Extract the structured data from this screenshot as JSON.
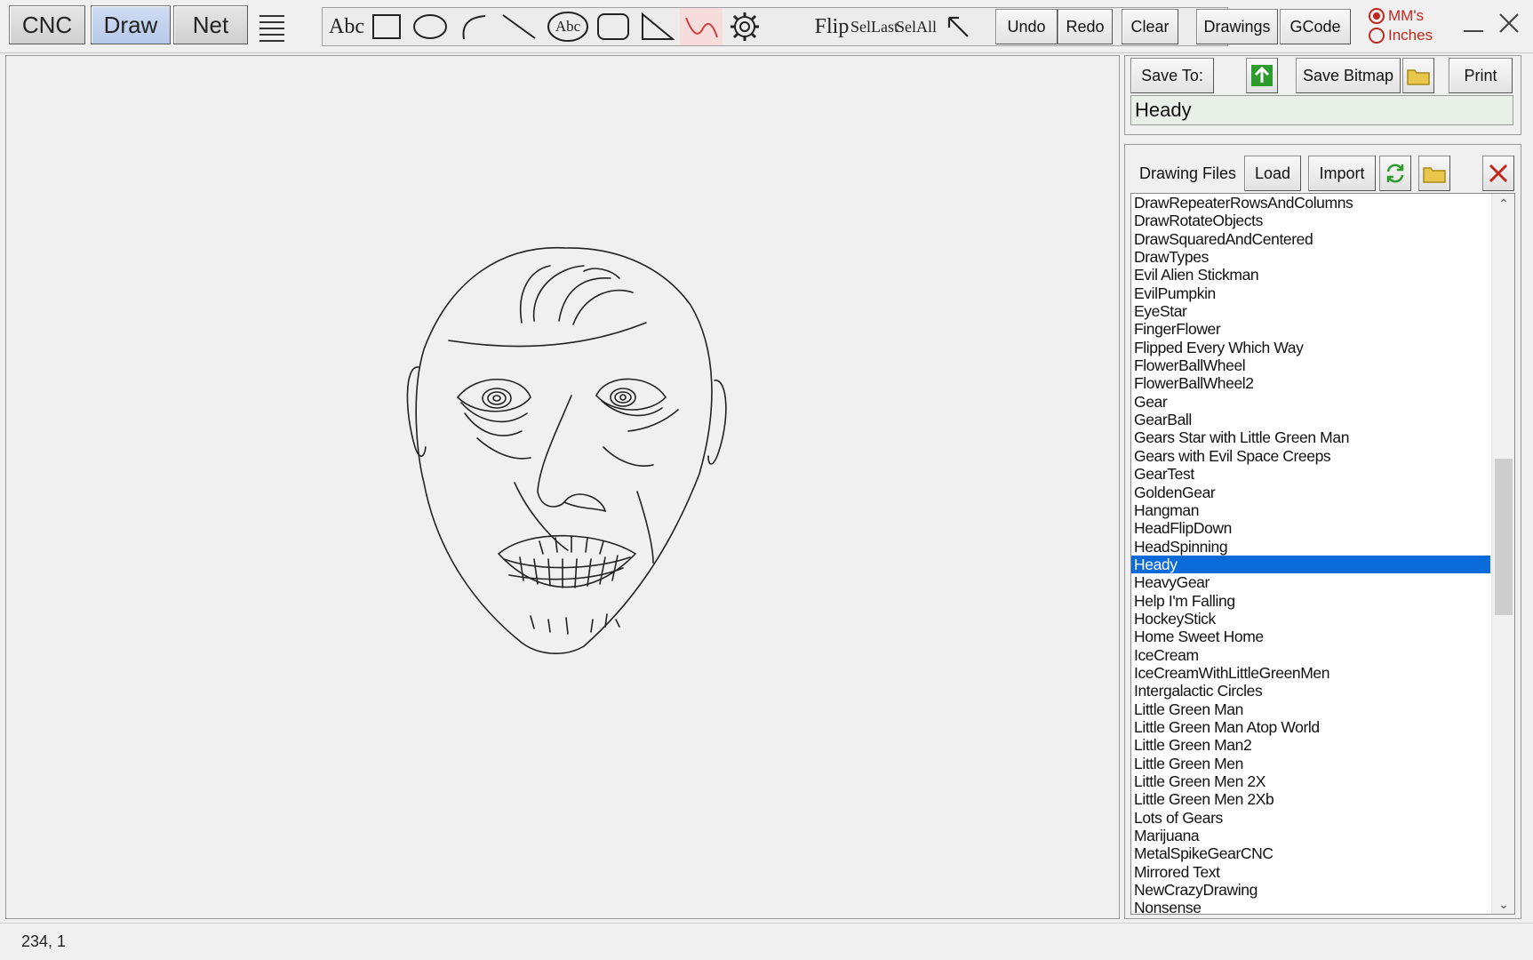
{
  "modes": {
    "cnc": "CNC",
    "draw": "Draw",
    "net": "Net",
    "active": "draw"
  },
  "tools": {
    "text": "Abc",
    "text_circle": "Abc",
    "flip": "Flip",
    "sel_last": [
      "Sel",
      "Last"
    ],
    "sel_all": [
      "Sel",
      "All"
    ],
    "selected_tool": "curve-tool"
  },
  "buttons": {
    "undo": "Undo",
    "redo": "Redo",
    "clear": "Clear",
    "drawings": "Drawings",
    "gcode": "GCode",
    "save_to": "Save To:",
    "save_bitmap": "Save Bitmap",
    "print": "Print",
    "load": "Load",
    "import": "Import"
  },
  "units": {
    "mm": "MM's",
    "inches": "Inches",
    "selected": "mm"
  },
  "save_panel": {
    "filename": "Heady"
  },
  "files_panel": {
    "label": "Drawing Files",
    "selected": "Heady",
    "scroll_thumb_fraction": [
      0.36,
      0.59
    ],
    "items": [
      "DrawRepeaterRowsAndColumns",
      "DrawRotateObjects",
      "DrawSquaredAndCentered",
      "DrawTypes",
      "Evil Alien Stickman",
      "EvilPumpkin",
      "EyeStar",
      "FingerFlower",
      "Flipped Every Which Way",
      "FlowerBallWheel",
      "FlowerBallWheel2",
      "Gear",
      "GearBall",
      "Gears Star with Little Green Man",
      "Gears with Evil Space Creeps",
      "GearTest",
      "GoldenGear",
      "Hangman",
      "HeadFlipDown",
      "HeadSpinning",
      "Heady",
      "HeavyGear",
      "Help I'm Falling",
      "HockeyStick",
      "Home Sweet Home",
      "IceCream",
      "IceCreamWithLittleGreenMen",
      "Intergalactic Circles",
      "Little Green Man",
      "Little Green Man Atop World",
      "Little Green Man2",
      "Little Green Men",
      "Little Green Men 2X",
      "Little Green Men 2Xb",
      "Lots of Gears",
      "Marijuana",
      "MetalSpikeGearCNC",
      "Mirrored Text",
      "NewCrazyDrawing",
      "Nonsense"
    ]
  },
  "status": {
    "coords": "234, 1"
  },
  "colors": {
    "selection": "#0a6ad9",
    "units_accent": "#c0281e",
    "refresh_icon": "#2e9b2e",
    "close_icon": "#c0281e"
  }
}
